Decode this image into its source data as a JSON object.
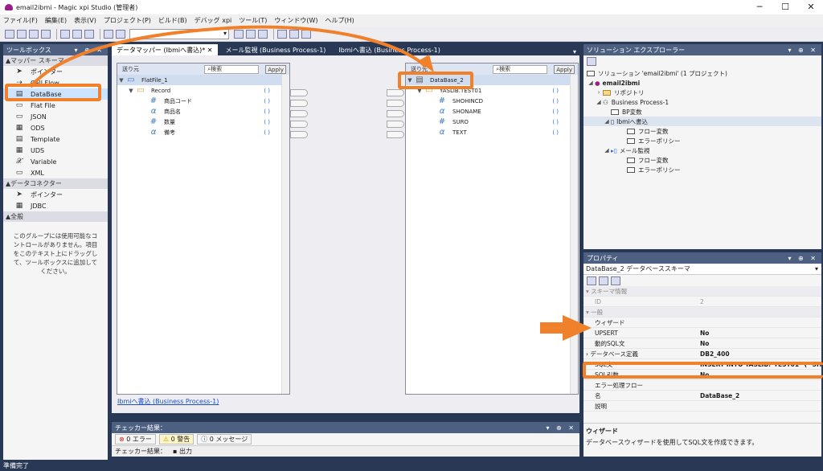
{
  "window": {
    "title": "email2ibmi - Magic xpi Studio (管理者)",
    "minimize": "─",
    "maximize": "☐",
    "close": "✕"
  },
  "menu": [
    "ファイル(F)",
    "編集(E)",
    "表示(V)",
    "プロジェクト(P)",
    "ビルド(B)",
    "デバッグ xpi",
    "ツール(T)",
    "ウィンドウ(W)",
    "ヘルプ(H)"
  ],
  "toolbox": {
    "title": "ツールボックス",
    "cat1": "マッパー スキーマ",
    "items1": [
      {
        "icon": "pointer-icon",
        "glyph": "➤",
        "label": "ポインター"
      },
      {
        "icon": "call-flow-icon",
        "glyph": "⇢",
        "label": "Call Flow"
      },
      {
        "icon": "database-icon",
        "glyph": "▤",
        "label": "DataBase"
      },
      {
        "icon": "flat-file-icon",
        "glyph": "▭",
        "label": "Flat File"
      },
      {
        "icon": "json-icon",
        "glyph": "▭",
        "label": "JSON"
      },
      {
        "icon": "ods-icon",
        "glyph": "▦",
        "label": "ODS"
      },
      {
        "icon": "template-icon",
        "glyph": "▤",
        "label": "Template"
      },
      {
        "icon": "uds-icon",
        "glyph": "▦",
        "label": "UDS"
      },
      {
        "icon": "variable-icon",
        "glyph": "𝒳",
        "label": "Variable"
      },
      {
        "icon": "xml-icon",
        "glyph": "▭",
        "label": "XML"
      }
    ],
    "cat2": "データコネクター",
    "items2": [
      {
        "icon": "pointer-icon",
        "glyph": "➤",
        "label": "ポインター"
      },
      {
        "icon": "jdbc-icon",
        "glyph": "▦",
        "label": "JDBC"
      }
    ],
    "cat3": "全般",
    "note": "このグループには使用可能なコントロールがありません。項目をこのテキスト上にドラッグして、ツールボックスに追加してください。"
  },
  "tabs": [
    {
      "label": "データマッパー (Ibmiへ書込)*",
      "close": "✕"
    },
    {
      "label": "メール監視 (Business Process-1)"
    },
    {
      "label": "Ibmiへ書込 (Business Process-1)"
    }
  ],
  "mapper": {
    "source": {
      "header": "送り元",
      "search": "検索",
      "apply": "Apply",
      "rows": [
        {
          "sym": "▭",
          "label": "FlatFile_1",
          "val": ""
        },
        {
          "sym": "▭",
          "label": "Record",
          "val": "( )"
        },
        {
          "sym": "#",
          "label": "商品コード",
          "val": "( )"
        },
        {
          "sym": "α",
          "label": "商品名",
          "val": "( )"
        },
        {
          "sym": "#",
          "label": "数量",
          "val": "( )"
        },
        {
          "sym": "α",
          "label": "備考",
          "val": "( )"
        }
      ]
    },
    "dest": {
      "header": "送り先",
      "search": "検索",
      "apply": "Apply",
      "rows": [
        {
          "sym": "▤",
          "label": "DataBase_2",
          "val": ""
        },
        {
          "sym": "▭",
          "label": "YASLIB.TEST01",
          "val": "( )"
        },
        {
          "sym": "#",
          "label": "SHOHINCD",
          "val": "( )"
        },
        {
          "sym": "α",
          "label": "SHONAME",
          "val": "( )"
        },
        {
          "sym": "#",
          "label": "SURO",
          "val": "( )"
        },
        {
          "sym": "α",
          "label": "TEXT",
          "val": "( )"
        }
      ]
    },
    "breadcrumb": "Ibmiへ書込 (Business Process-1)"
  },
  "checker": {
    "title": "チェッカー結果：",
    "errors": "0 エラー",
    "warnings": "0 警告",
    "messages": "0 メッセージ",
    "tab1": "チェッカー結果：",
    "tab2": "出力"
  },
  "solution": {
    "title": "ソリューション エクスプローラー",
    "root": "ソリューション 'email2ibmi' (1 プロジェクト)",
    "project": "email2ibmi",
    "repo": "リポジトリ",
    "bp": "Business Process-1",
    "bpvar": "BP変数",
    "flow1": "Ibmiへ書込",
    "flowvar": "フロー変数",
    "errpol": "エラーポリシー",
    "flow2": "メール監視",
    "flowvar2": "フロー変数",
    "errpol2": "エラーポリシー"
  },
  "properties": {
    "title": "プロパティ",
    "object": "DataBase_2  データベーススキーマ",
    "cat_schema": "スキーマ情報",
    "id_name": "ID",
    "id_val": "2",
    "cat_general": "一般",
    "rows": [
      {
        "name": "ウィザード",
        "val": ""
      },
      {
        "name": "UPSERT",
        "val": "No"
      },
      {
        "name": "動的SQL文",
        "val": "No"
      },
      {
        "name": "データベース定義",
        "val": "DB2_400"
      },
      {
        "name": "SQL文",
        "val": "INSERT INTO YASLIB.\"TEST01\" ( \"SHOHIN"
      },
      {
        "name": "SQL引数",
        "val": "No"
      },
      {
        "name": "エラー処理フロー",
        "val": ""
      },
      {
        "name": "名",
        "val": "DataBase_2"
      },
      {
        "name": "説明",
        "val": ""
      }
    ],
    "desc_title": "ウィザード",
    "desc_text": "データベースウィザードを使用してSQL文を作成できます。"
  },
  "status": "準備完了",
  "colors": {
    "accent": "#f0802a",
    "frame": "#293955",
    "header": "#4d6082"
  }
}
